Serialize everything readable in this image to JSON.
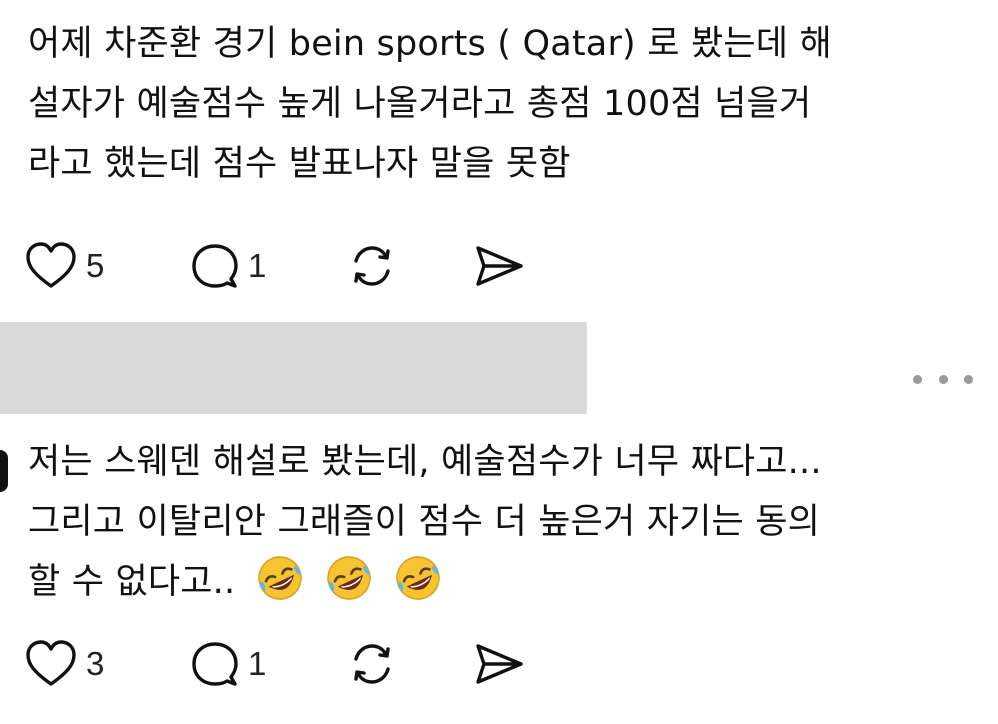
{
  "comments": [
    {
      "lines": [
        "어제 차준환 경기 bein sports ( Qatar) 로 봤는데 해",
        "설자가 예술점수 높게 나올거라고 총점 100점 넘을거",
        "라고 했는데 점수 발표나자 말을 못함"
      ],
      "likes": "5",
      "replies": "1"
    },
    {
      "lines": [
        "저는 스웨덴 해설로 봤는데, 예술점수가 너무 짜다고...",
        "그리고 이탈리안 그래즐이 점수 더 높은거 자기는 동의",
        "할 수 없다고.."
      ],
      "emoji": [
        "rolling-on-the-floor-laughing",
        "rolling-on-the-floor-laughing",
        "rolling-on-the-floor-laughing"
      ],
      "likes": "3",
      "replies": "1"
    }
  ]
}
